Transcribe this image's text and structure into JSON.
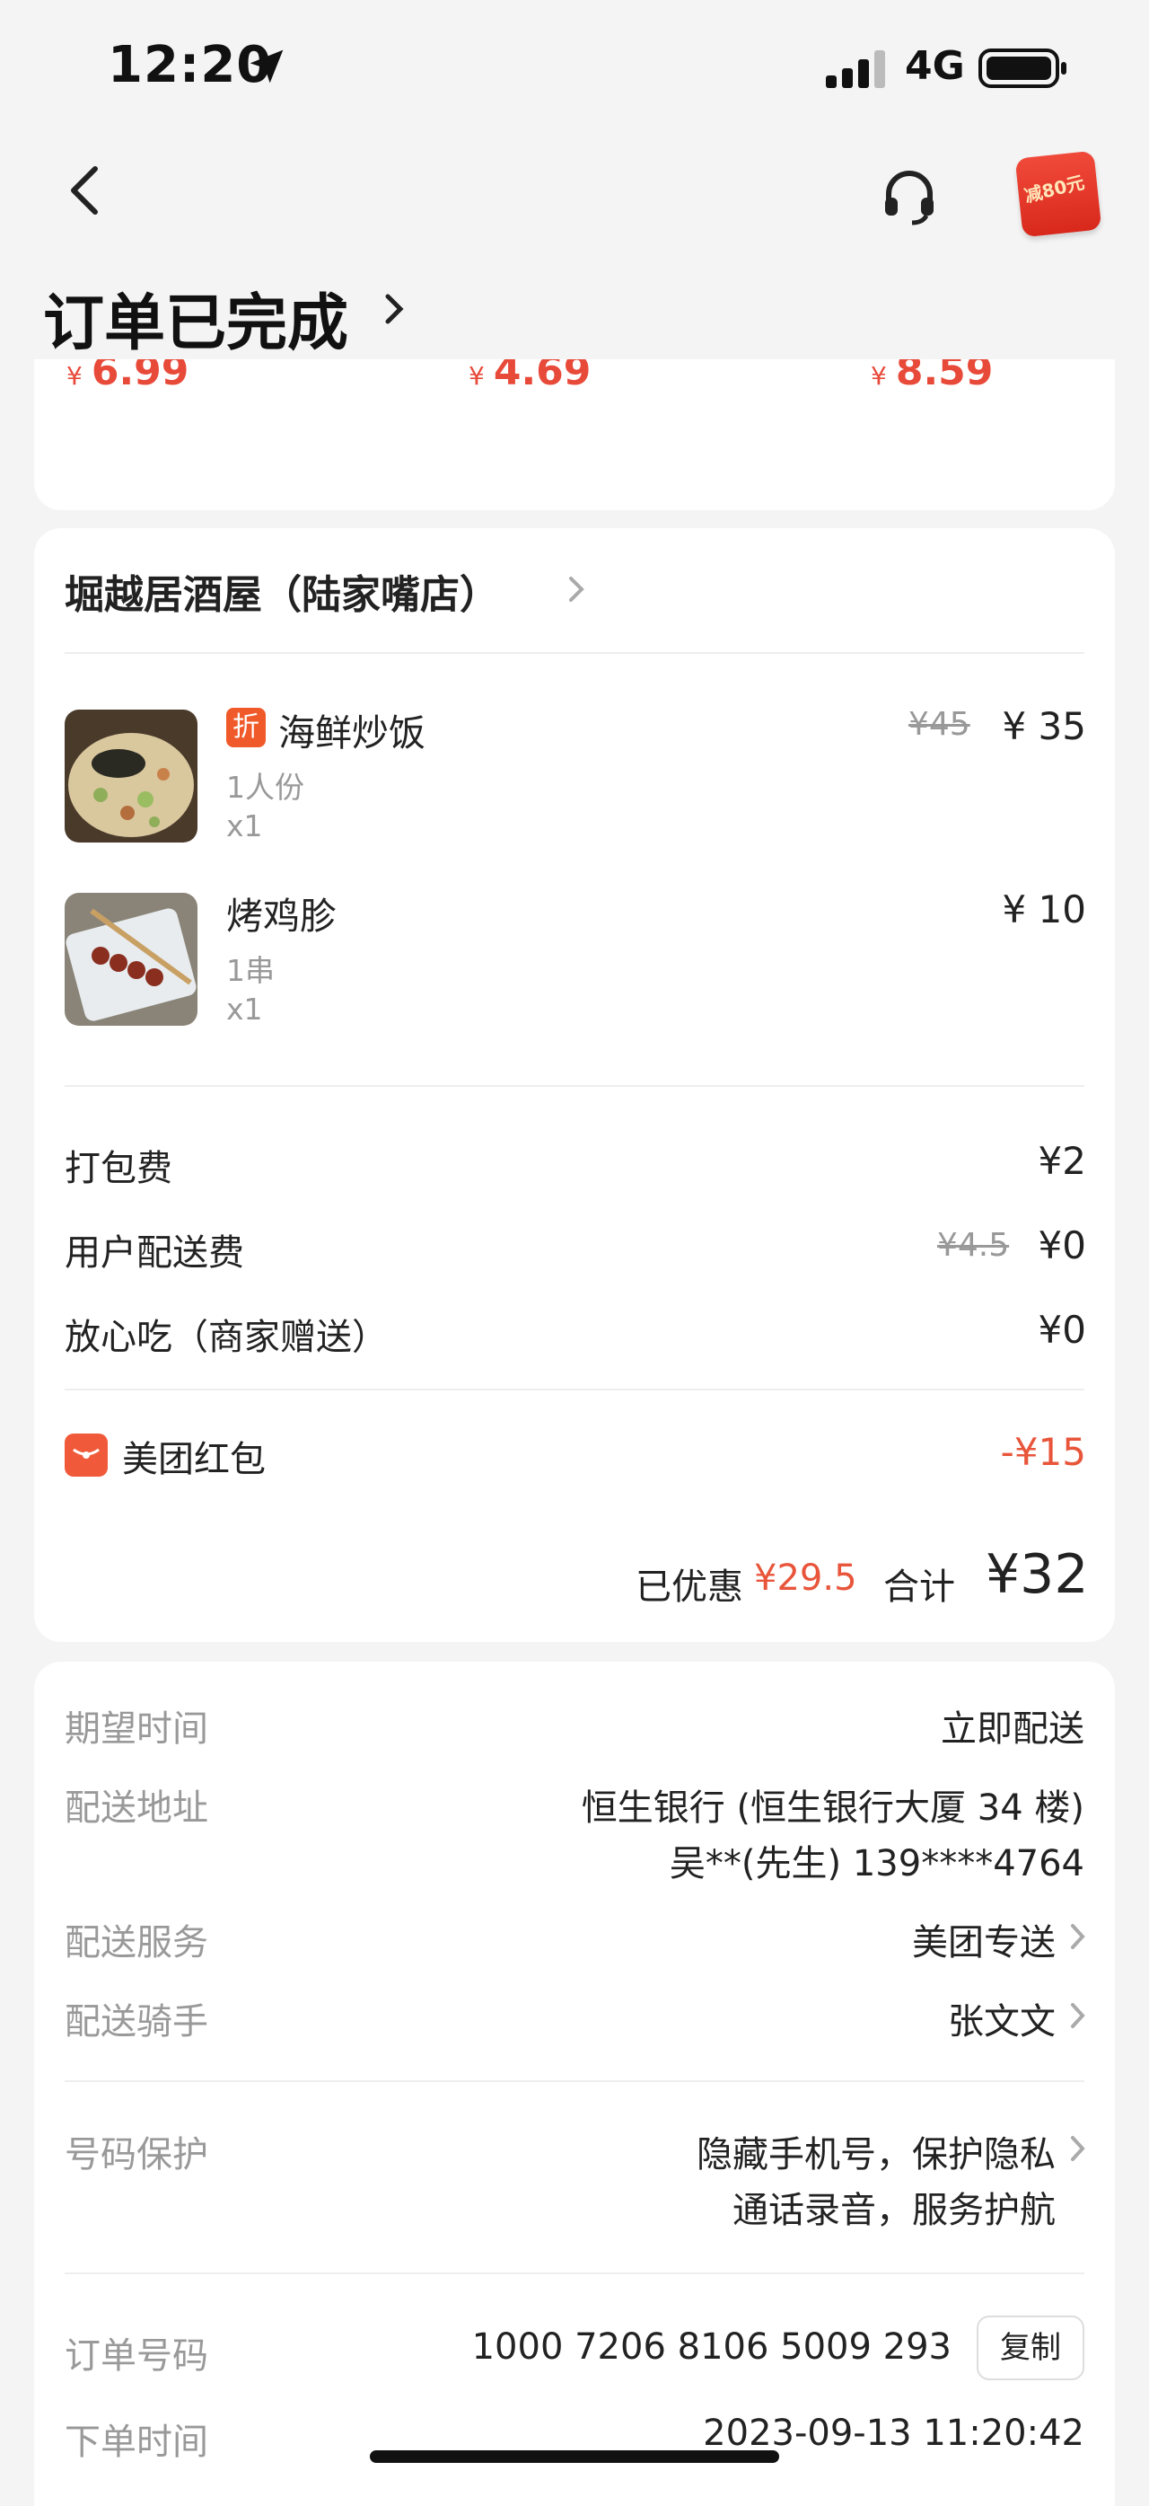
{
  "status_bar": {
    "time": "12:20",
    "network": "4G"
  },
  "header": {
    "title": "订单已完成",
    "coupon_badge": "减80元"
  },
  "partial_card": {
    "prices": [
      "6.99",
      "4.69",
      "8.59"
    ],
    "currency": "¥"
  },
  "shop": {
    "name": "堀越居酒屋（陆家嘴店）"
  },
  "items": [
    {
      "name": "海鲜炒饭",
      "spec": "1人份",
      "qty": "x1",
      "original_price": "¥45",
      "price": "¥ 35",
      "discount_tag": "折"
    },
    {
      "name": "烤鸡胗",
      "spec": "1串",
      "qty": "x1",
      "price": "¥ 10"
    }
  ],
  "fees": [
    {
      "label": "打包费",
      "value": "¥2"
    },
    {
      "label": "用户配送费",
      "original": "¥4.5",
      "value": "¥0"
    },
    {
      "label": "放心吃（商家赠送）",
      "value": "¥0"
    }
  ],
  "red_packet": {
    "label": "美团红包",
    "value": "-¥15"
  },
  "summary": {
    "saved_label": "已优惠",
    "saved_value": "¥29.5",
    "total_label": "合计",
    "total_value": "¥32"
  },
  "delivery": {
    "expected_time_label": "期望时间",
    "expected_time_value": "立即配送",
    "address_label": "配送地址",
    "address_line1": "恒生银行 (恒生银行大厦 34 楼)",
    "address_line2": "吴**(先生) 139****4764",
    "service_label": "配送服务",
    "service_value": "美团专送",
    "rider_label": "配送骑手",
    "rider_value": "张文文",
    "privacy_label": "号码保护",
    "privacy_line1": "隐藏手机号，保护隐私",
    "privacy_line2": "通话录音，服务护航",
    "order_no_label": "订单号码",
    "order_no_value": "1000 7206 8106 5009 293",
    "copy_label": "复制",
    "order_time_label": "下单时间",
    "order_time_value": "2023-09-13 11:20:42"
  },
  "colors": {
    "accent_red": "#e84a3a",
    "page_bg": "#f4f4f4"
  }
}
